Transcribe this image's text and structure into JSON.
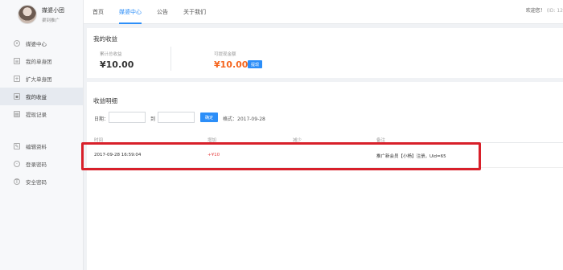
{
  "profile": {
    "name": "媒婆小团",
    "role": "渠到推广"
  },
  "sidebar": {
    "items": [
      {
        "label": "媒婆中心",
        "icon": "person-icon"
      },
      {
        "label": "我的单身团",
        "icon": "group-icon"
      },
      {
        "label": "扩大单身团",
        "icon": "expand-icon"
      },
      {
        "label": "我的收益",
        "icon": "income-icon"
      },
      {
        "label": "提现记录",
        "icon": "record-icon"
      },
      {
        "label": "编辑资料",
        "icon": "edit-icon"
      },
      {
        "label": "登录密码",
        "icon": "lock-icon"
      },
      {
        "label": "安全密码",
        "icon": "shield-icon"
      }
    ]
  },
  "nav": {
    "items": [
      "首页",
      "媒婆中心",
      "公告",
      "关于我们"
    ]
  },
  "welcome": {
    "text": "欢迎您！",
    "id": "(ID: 12"
  },
  "income": {
    "title": "我的收益",
    "total_label": "累计总收益",
    "total_value": "¥10.00",
    "withdrawable_label": "可提现金额",
    "withdrawable_value": "¥10.00",
    "withdraw_button": "提现"
  },
  "details": {
    "title": "收益明细",
    "date_label": "日期：",
    "to_label": "到",
    "confirm_button": "确定",
    "format_hint": "格式：2017-09-28",
    "columns": [
      "时间",
      "增加",
      "减少",
      "备注"
    ],
    "rows": [
      {
        "time": "2017-09-28 16:59:04",
        "increase": "+¥10",
        "decrease": "",
        "note": "推广新会员【小杨】注册，Uid=65"
      }
    ]
  }
}
